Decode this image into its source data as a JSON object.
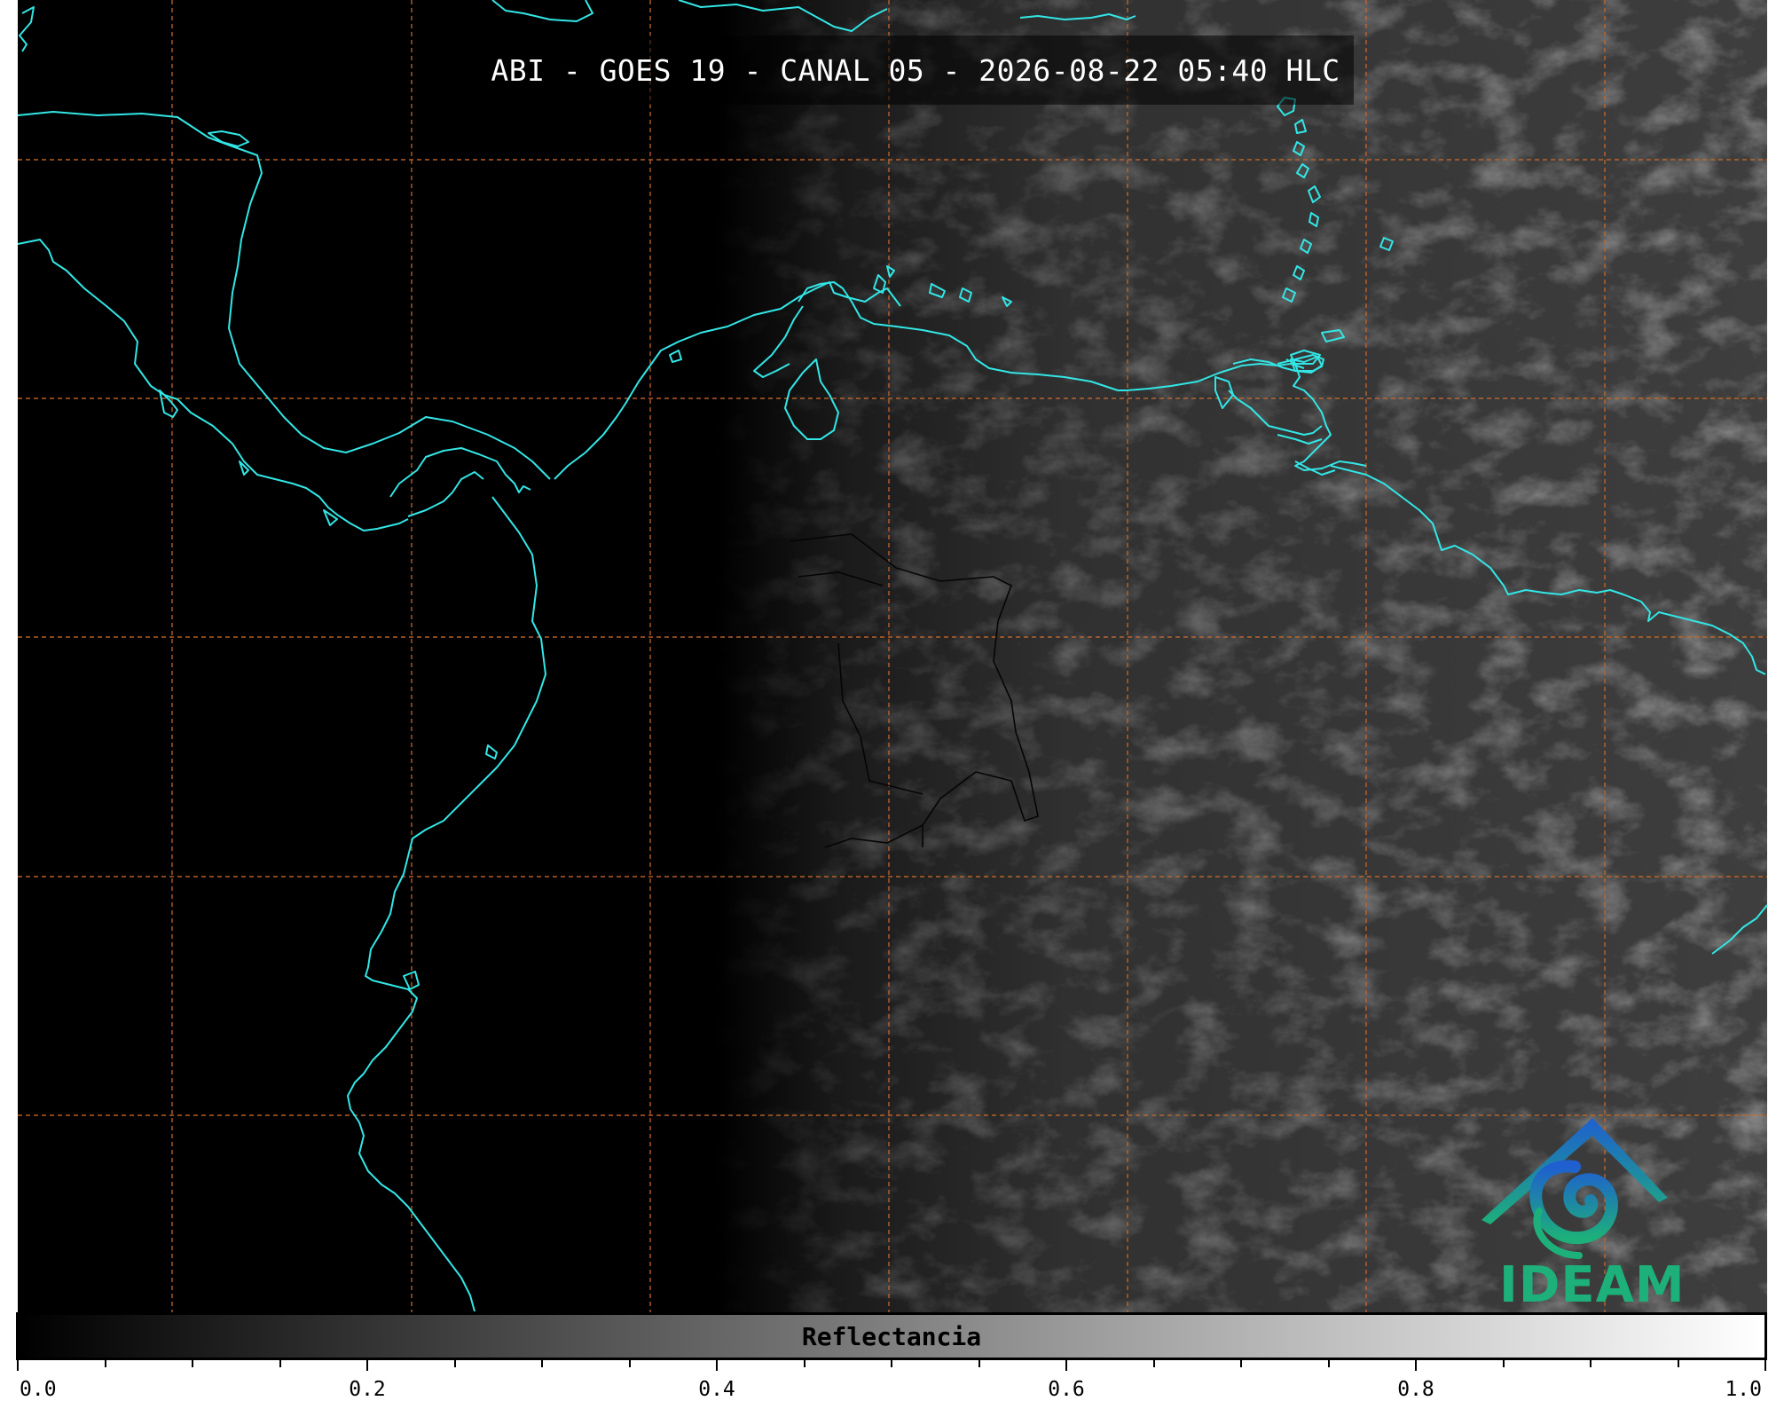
{
  "title": "ABI - GOES 19 - CANAL 05 - 2026-08-22 05:40 HLC",
  "colorbar": {
    "label": "Reflectancia",
    "ticks": [
      "0.0",
      "0.2",
      "0.4",
      "0.6",
      "0.8",
      "1.0"
    ],
    "range": [
      0.0,
      1.0
    ],
    "colormap": "greyscale"
  },
  "logo": {
    "text": "IDEAM",
    "color": "#1db07a"
  },
  "map": {
    "background_color": "#000000",
    "coastline_color": "#33e6e6",
    "gridline_color": "#c8682a",
    "gridline_style": "dashed"
  }
}
